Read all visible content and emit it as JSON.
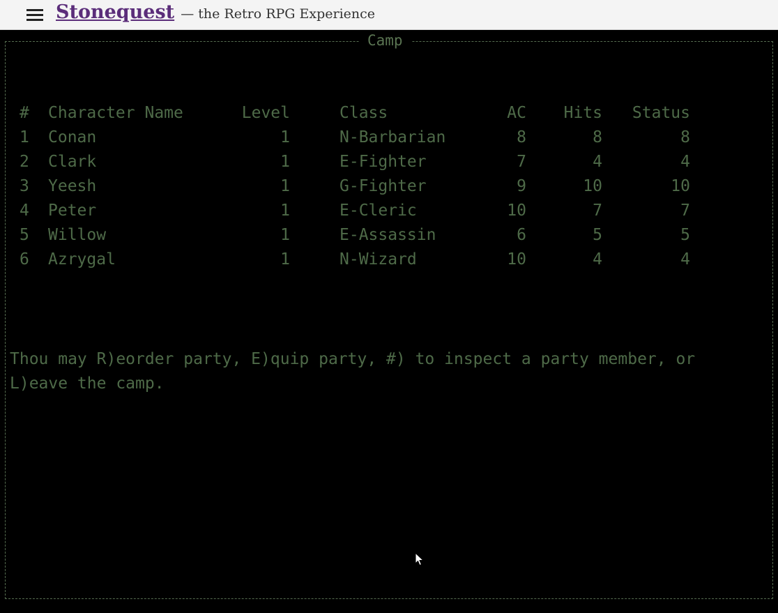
{
  "header": {
    "title": "Stonequest",
    "tagline": "— the Retro RPG Experience"
  },
  "camp": {
    "frame_title": "Camp",
    "columns": {
      "num": "#",
      "name": "Character Name",
      "level": "Level",
      "class": "Class",
      "ac": "AC",
      "hits": "Hits",
      "status": "Status"
    },
    "party": [
      {
        "num": "1",
        "name": "Conan",
        "level": "1",
        "class": "N-Barbarian",
        "ac": "8",
        "hits": "8",
        "status": "8"
      },
      {
        "num": "2",
        "name": "Clark",
        "level": "1",
        "class": "E-Fighter",
        "ac": "7",
        "hits": "4",
        "status": "4"
      },
      {
        "num": "3",
        "name": "Yeesh",
        "level": "1",
        "class": "G-Fighter",
        "ac": "9",
        "hits": "10",
        "status": "10"
      },
      {
        "num": "4",
        "name": "Peter",
        "level": "1",
        "class": "E-Cleric",
        "ac": "10",
        "hits": "7",
        "status": "7"
      },
      {
        "num": "5",
        "name": "Willow",
        "level": "1",
        "class": "E-Assassin",
        "ac": "6",
        "hits": "5",
        "status": "5"
      },
      {
        "num": "6",
        "name": "Azrygal",
        "level": "1",
        "class": "N-Wizard",
        "ac": "10",
        "hits": "4",
        "status": "4"
      }
    ],
    "message_line1": "Thou may R)eorder party, E)quip party, #) to inspect a party member, or",
    "message_line2": "L)eave the camp."
  },
  "colors": {
    "terminal_text": "#4e6a48",
    "brand": "#5b2d7a",
    "background": "#000000"
  }
}
